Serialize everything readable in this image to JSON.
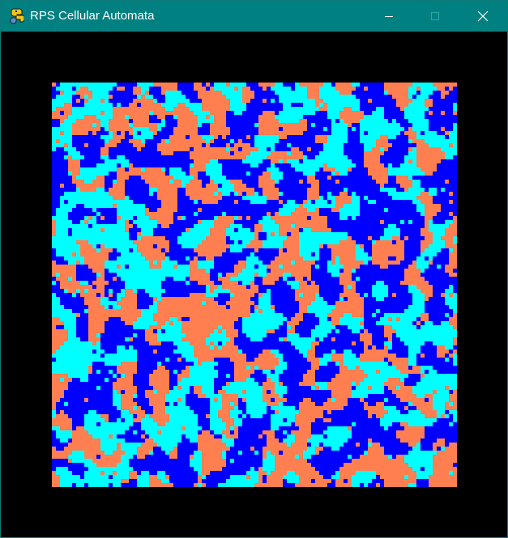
{
  "window": {
    "title": "RPS Cellular Automata",
    "icon": "python-snake-icon",
    "controls": [
      "minimize-icon",
      "maximize-icon",
      "close-icon"
    ],
    "titlebar_color": "#008080"
  },
  "canvas": {
    "background": "#000000",
    "palette": {
      "rock": "#0000ff",
      "paper": "#00ffff",
      "scissors": "#ff7f50"
    }
  }
}
